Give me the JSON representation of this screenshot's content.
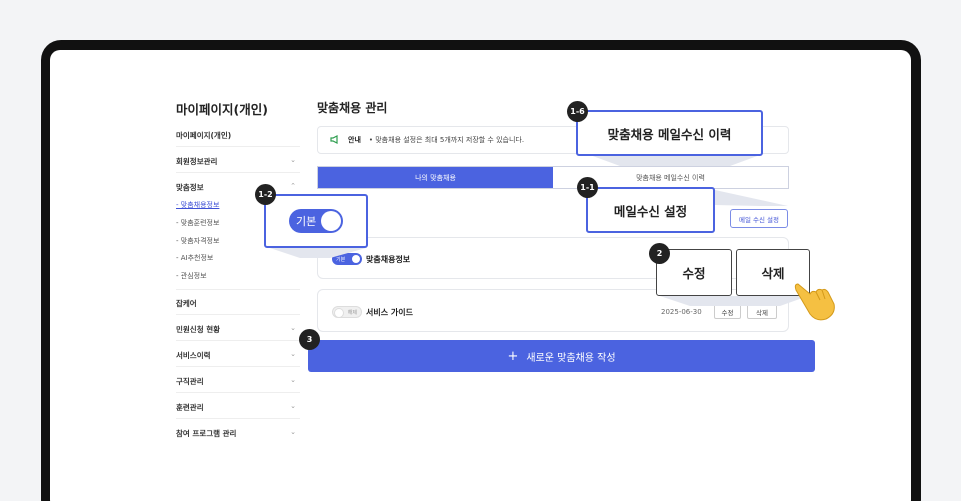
{
  "sidebar": {
    "title": "마이페이지(개인)",
    "items": [
      {
        "label": "마이페이지(개인)",
        "chev": ""
      },
      {
        "label": "회원정보관리",
        "chev": "⌄"
      },
      {
        "label": "맞춤정보",
        "chev": "⌃"
      },
      {
        "label": "잡케어",
        "chev": ""
      },
      {
        "label": "민원신청 현황",
        "chev": "⌄"
      },
      {
        "label": "서비스이력",
        "chev": "⌄"
      },
      {
        "label": "구직관리",
        "chev": "⌄"
      },
      {
        "label": "훈련관리",
        "chev": "⌄"
      },
      {
        "label": "참여 프로그램 관리",
        "chev": "⌄"
      }
    ],
    "subitems": [
      "- 맞춤채용정보",
      "- 맞춤훈련정보",
      "- 맞춤자격정보",
      "- AI추천정보",
      "- 관심정보"
    ]
  },
  "main": {
    "title": "맞춤채용 관리",
    "notice_label": "안내",
    "notice_text": "• 맞춤채용 설정은 최대 5개까지 저장할 수 있습니다.",
    "tabs": [
      "나의 맞춤채용",
      "맞춤채용 메일수신 이력"
    ],
    "mail_setting_button": "메일 수신 설정",
    "cards": [
      {
        "toggle": "기본",
        "title": "맞춤채용정보",
        "date": "",
        "edit": "",
        "delete": ""
      },
      {
        "toggle": "해제",
        "title": "서비스 가이드",
        "date": "2025-06-30",
        "edit": "수정",
        "delete": "삭제"
      }
    ],
    "new_button": "새로운 맞춤채용 작성",
    "new_icon": "+"
  },
  "callouts": {
    "c16": {
      "badge": "1-6",
      "text": "맞춤채용 메일수신 이력"
    },
    "c11": {
      "badge": "1-1",
      "text": "메일수신 설정"
    },
    "c12": {
      "badge": "1-2",
      "text": "기본"
    },
    "c2": {
      "badge": "2",
      "edit": "수정",
      "delete": "삭제"
    },
    "c3": {
      "badge": "3"
    }
  },
  "colors": {
    "accent": "#4b63e0",
    "frame": "#111111"
  }
}
